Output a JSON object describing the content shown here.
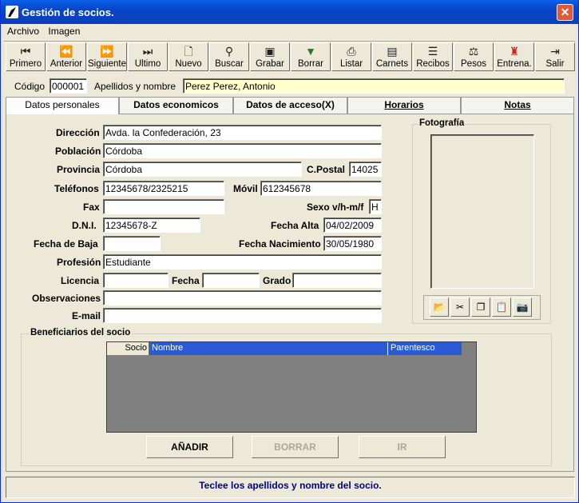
{
  "window": {
    "title": "Gestión de socios.",
    "close_label": "✕"
  },
  "menu": [
    "Archivo",
    "Imagen"
  ],
  "toolbar": [
    {
      "label": "Primero",
      "icon": "first-icon"
    },
    {
      "label": "Anterior",
      "icon": "previous-icon"
    },
    {
      "label": "Siguiente",
      "icon": "next-icon"
    },
    {
      "label": "Ultimo",
      "icon": "last-icon"
    },
    {
      "label": "Nuevo",
      "icon": "new-document-icon"
    },
    {
      "label": "Buscar",
      "icon": "binoculars-icon"
    },
    {
      "label": "Grabar",
      "icon": "save-disk-icon"
    },
    {
      "label": "Borrar",
      "icon": "trash-icon"
    },
    {
      "label": "Listar",
      "icon": "printer-icon"
    },
    {
      "label": "Carnets",
      "icon": "id-card-icon"
    },
    {
      "label": "Recibos",
      "icon": "receipt-icon"
    },
    {
      "label": "Pesos",
      "icon": "scale-icon"
    },
    {
      "label": "Entrena.",
      "icon": "trainer-icon"
    },
    {
      "label": "Salir",
      "icon": "exit-door-icon"
    }
  ],
  "header": {
    "codigo_label": "Código",
    "codigo_value": "000001",
    "nombre_label": "Apellidos y nombre",
    "nombre_value": "Perez Perez, Antonio"
  },
  "tabs": [
    "Datos personales",
    "Datos economicos",
    "Datos de acceso(X)",
    "Horarios",
    "Notas"
  ],
  "form": {
    "direccion_label": "Dirección",
    "direccion": "Avda. la Confederación, 23",
    "poblacion_label": "Población",
    "poblacion": "Córdoba",
    "provincia_label": "Provincia",
    "provincia": "Córdoba",
    "cpostal_label": "C.Postal",
    "cpostal": "14025",
    "telefonos_label": "Teléfonos",
    "telefonos": "12345678/2325215",
    "movil_label": "Móvil",
    "movil": "612345678",
    "fax_label": "Fax",
    "fax": "",
    "sexo_label": "Sexo v/h-m/f",
    "sexo": "H",
    "dni_label": "D.N.I.",
    "dni": "12345678-Z",
    "fecha_alta_label": "Fecha Alta",
    "fecha_alta": "04/02/2009",
    "fecha_baja_label": "Fecha de Baja",
    "fecha_baja": "",
    "fecha_nac_label": "Fecha Nacimiento",
    "fecha_nac": "30/05/1980",
    "profesion_label": "Profesión",
    "profesion": "Estudiante",
    "licencia_label": "Licencia",
    "licencia": "",
    "fecha_label": "Fecha",
    "fecha": "",
    "grado_label": "Grado",
    "grado": "",
    "observaciones_label": "Observaciones",
    "observaciones": "",
    "email_label": "E-mail",
    "email": ""
  },
  "photo": {
    "title": "Fotografía"
  },
  "photo_buttons": [
    "open-folder-icon",
    "cut-icon",
    "copy-icon",
    "paste-icon",
    "camera-icon"
  ],
  "beneficiarios": {
    "title": "Beneficiarios del socio",
    "columns": [
      "Socio",
      "Nombre",
      "Parentesco"
    ],
    "add_label": "AÑADIR",
    "delete_label": "BORRAR",
    "go_label": "IR"
  },
  "status": "Teclee los apellidos y nombre del socio.",
  "colors": {
    "accent": "#0a5fe8",
    "highlight_input": "#ffffcc",
    "status_text": "#00008b"
  }
}
